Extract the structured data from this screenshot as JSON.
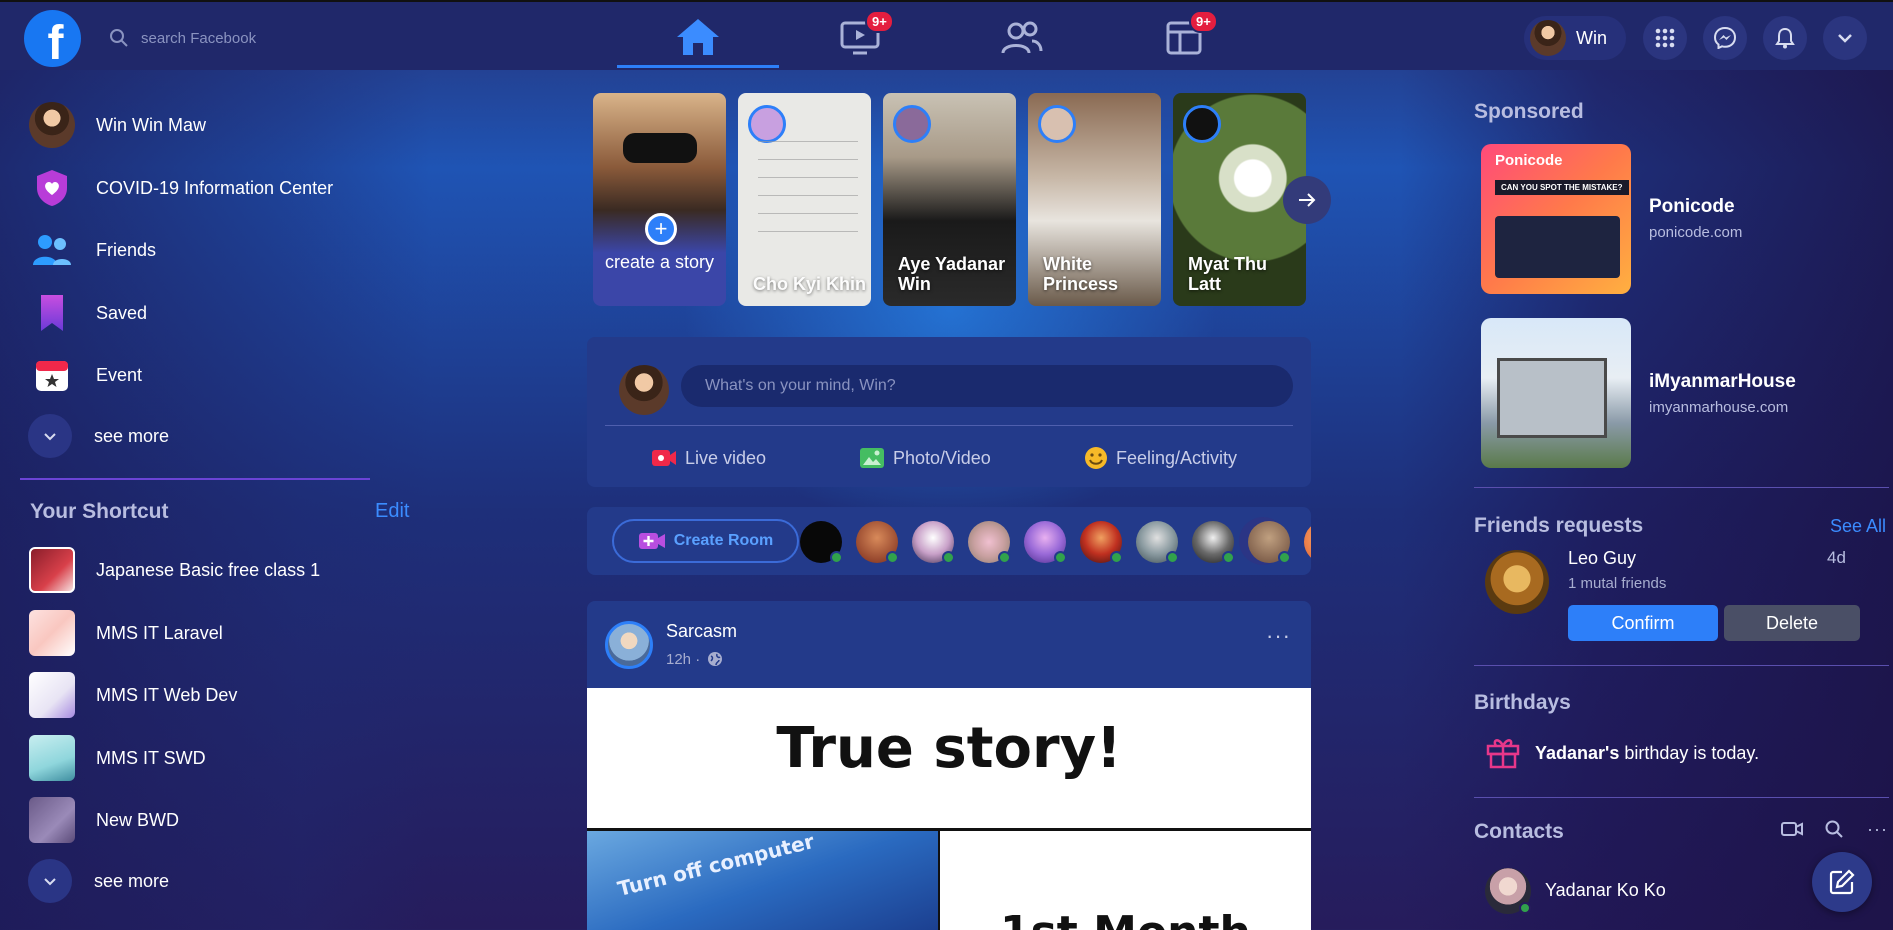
{
  "topbar": {
    "logo": "f",
    "search_placeholder": "search Facebook",
    "nav": [
      {
        "name": "home",
        "badge": ""
      },
      {
        "name": "watch",
        "badge": "9+"
      },
      {
        "name": "groups",
        "badge": ""
      },
      {
        "name": "pages",
        "badge": "9+"
      }
    ],
    "profile_name": "Win"
  },
  "sidebar": {
    "items": [
      {
        "label": "Win Win Maw",
        "icon": "avatar"
      },
      {
        "label": "COVID-19 Information Center",
        "icon": "covid-shield-icon"
      },
      {
        "label": "Friends",
        "icon": "friends-icon"
      },
      {
        "label": "Saved",
        "icon": "saved-bookmark-icon"
      },
      {
        "label": "Event",
        "icon": "event-calendar-icon"
      }
    ],
    "see_more": "see more",
    "shortcut_title": "Your Shortcut",
    "shortcut_edit": "Edit",
    "shortcuts": [
      {
        "label": "Japanese Basic free class 1"
      },
      {
        "label": "MMS IT Laravel"
      },
      {
        "label": "MMS IT Web Dev"
      },
      {
        "label": "MMS IT SWD"
      },
      {
        "label": "New BWD"
      }
    ],
    "see_more_2": "see more"
  },
  "stories": {
    "create_label": "create a story",
    "items": [
      {
        "name": "Cho Kyi Khin"
      },
      {
        "name": "Aye Yadanar Win"
      },
      {
        "name": "White Princess"
      },
      {
        "name": "Myat Thu Latt"
      }
    ]
  },
  "composer": {
    "placeholder": "What's on your mind, Win?",
    "actions": [
      "Live video",
      "Photo/Video",
      "Feeling/Activity"
    ]
  },
  "rooms": {
    "create_label": "Create Room"
  },
  "post": {
    "author": "Sarcasm",
    "time": "12h ·",
    "more": "···",
    "headline": "True story!",
    "image_text_1": "Turn off computer",
    "image_text_2": "1st Month"
  },
  "right": {
    "sponsored_title": "Sponsored",
    "ads": [
      {
        "title": "Ponicode",
        "url": "ponicode.com",
        "brand": "Ponicode",
        "tagline": "CAN YOU SPOT THE MISTAKE?"
      },
      {
        "title": "iMyanmarHouse",
        "url": "imyanmarhouse.com"
      }
    ],
    "friend_requests_title": "Friends requests",
    "see_all": "See All",
    "request": {
      "name": "Leo Guy",
      "mutual": "1 mutal friends",
      "time": "4d",
      "confirm": "Confirm",
      "delete": "Delete"
    },
    "birthdays_title": "Birthdays",
    "birthday_name": "Yadanar's",
    "birthday_text": " birthday is today.",
    "contacts_title": "Contacts",
    "contacts": [
      {
        "name": "Yadanar Ko Ko"
      }
    ]
  },
  "colors": {
    "accent": "#2d7ff9",
    "badge": "#e41e3f",
    "online": "#31a24c"
  }
}
